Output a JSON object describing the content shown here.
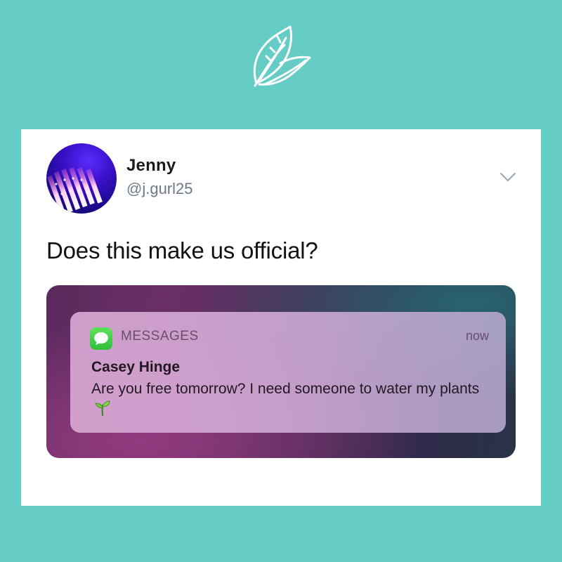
{
  "brand": {
    "logo_icon": "leaf-icon"
  },
  "tweet": {
    "user": {
      "name": "Jenny",
      "handle": "@j.gurl25",
      "avatar_icon": "led-lights-avatar"
    },
    "menu_icon": "chevron-down-icon",
    "text": "Does this make us official?"
  },
  "notification": {
    "app_icon": "messages-icon",
    "app_name": "MESSAGES",
    "time": "now",
    "sender": "Casey Hinge",
    "message": "Are you free tomorrow? I need someone to water my plants",
    "emoji": "🌱"
  },
  "colors": {
    "background": "#66ccc6",
    "card": "#ffffff",
    "handle": "#6d7a86",
    "messages_green": "#35c53f"
  }
}
